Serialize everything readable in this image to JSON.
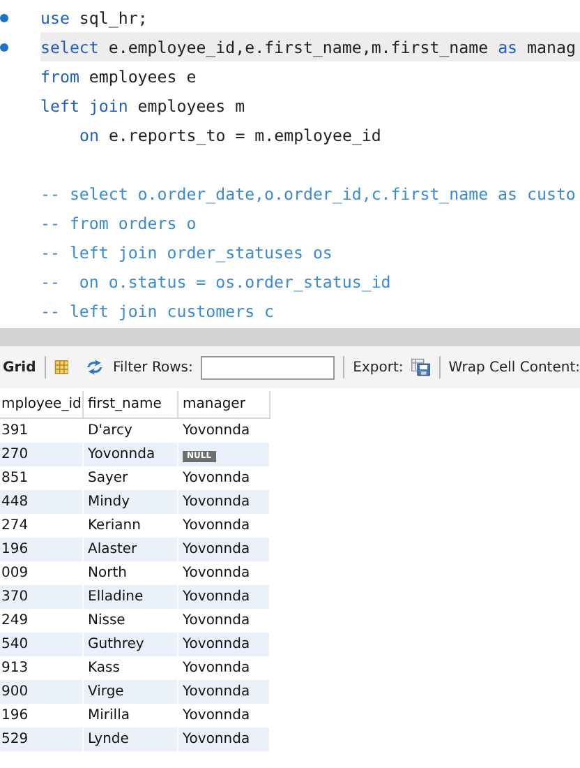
{
  "editor": {
    "lines": [
      {
        "marker": true,
        "current": false,
        "segments": [
          {
            "kind": "keyword",
            "text": "use"
          },
          {
            "kind": "plain",
            "text": " sql_hr;"
          }
        ]
      },
      {
        "marker": true,
        "current": true,
        "segments": [
          {
            "kind": "keyword",
            "text": "select"
          },
          {
            "kind": "plain",
            "text": " e.employee_id,e.first_name,m.first_name "
          },
          {
            "kind": "keyword",
            "text": "as"
          },
          {
            "kind": "plain",
            "text": " manag"
          }
        ]
      },
      {
        "marker": false,
        "current": false,
        "segments": [
          {
            "kind": "keyword",
            "text": "from"
          },
          {
            "kind": "plain",
            "text": " employees e"
          }
        ]
      },
      {
        "marker": false,
        "current": false,
        "segments": [
          {
            "kind": "keyword",
            "text": "left join"
          },
          {
            "kind": "plain",
            "text": " employees m"
          }
        ]
      },
      {
        "marker": false,
        "current": false,
        "indented": true,
        "segments": [
          {
            "kind": "keyword",
            "text": "on"
          },
          {
            "kind": "plain",
            "text": " e.reports_to = m.employee_id"
          }
        ]
      },
      {
        "marker": false,
        "current": false
      },
      {
        "marker": false,
        "current": false,
        "segments": [
          {
            "kind": "comment",
            "text": "-- select o.order_date,o.order_id,c.first_name as custo"
          }
        ]
      },
      {
        "marker": false,
        "current": false,
        "segments": [
          {
            "kind": "comment",
            "text": "-- from orders o"
          }
        ]
      },
      {
        "marker": false,
        "current": false,
        "segments": [
          {
            "kind": "comment",
            "text": "-- left join order_statuses os"
          }
        ]
      },
      {
        "marker": false,
        "current": false,
        "segments": [
          {
            "kind": "comment",
            "text": "--  on o.status = os.order_status_id"
          }
        ]
      },
      {
        "marker": false,
        "current": false,
        "segments": [
          {
            "kind": "comment",
            "text": "-- left join customers c"
          }
        ]
      }
    ]
  },
  "toolbar": {
    "grid_label": "Grid",
    "filter_label": "Filter Rows:",
    "export_label": "Export:",
    "wrap_label": "Wrap Cell Content:"
  },
  "table": {
    "columns": [
      "mployee_id",
      "first_name",
      "manager"
    ],
    "rows": [
      {
        "employee_id": "391",
        "first_name": "D'arcy",
        "manager": "Yovonnda",
        "manager_null": false
      },
      {
        "employee_id": "270",
        "first_name": "Yovonnda",
        "manager": "NULL",
        "manager_null": true
      },
      {
        "employee_id": "851",
        "first_name": "Sayer",
        "manager": "Yovonnda",
        "manager_null": false
      },
      {
        "employee_id": "448",
        "first_name": "Mindy",
        "manager": "Yovonnda",
        "manager_null": false
      },
      {
        "employee_id": "274",
        "first_name": "Keriann",
        "manager": "Yovonnda",
        "manager_null": false
      },
      {
        "employee_id": "196",
        "first_name": "Alaster",
        "manager": "Yovonnda",
        "manager_null": false
      },
      {
        "employee_id": "009",
        "first_name": "North",
        "manager": "Yovonnda",
        "manager_null": false
      },
      {
        "employee_id": "370",
        "first_name": "Elladine",
        "manager": "Yovonnda",
        "manager_null": false
      },
      {
        "employee_id": "249",
        "first_name": "Nisse",
        "manager": "Yovonnda",
        "manager_null": false
      },
      {
        "employee_id": "540",
        "first_name": "Guthrey",
        "manager": "Yovonnda",
        "manager_null": false
      },
      {
        "employee_id": "913",
        "first_name": "Kass",
        "manager": "Yovonnda",
        "manager_null": false
      },
      {
        "employee_id": "900",
        "first_name": "Virge",
        "manager": "Yovonnda",
        "manager_null": false
      },
      {
        "employee_id": "196",
        "first_name": "Mirilla",
        "manager": "Yovonnda",
        "manager_null": false
      },
      {
        "employee_id": "529",
        "first_name": "Lynde",
        "manager": "Yovonnda",
        "manager_null": false
      }
    ]
  }
}
